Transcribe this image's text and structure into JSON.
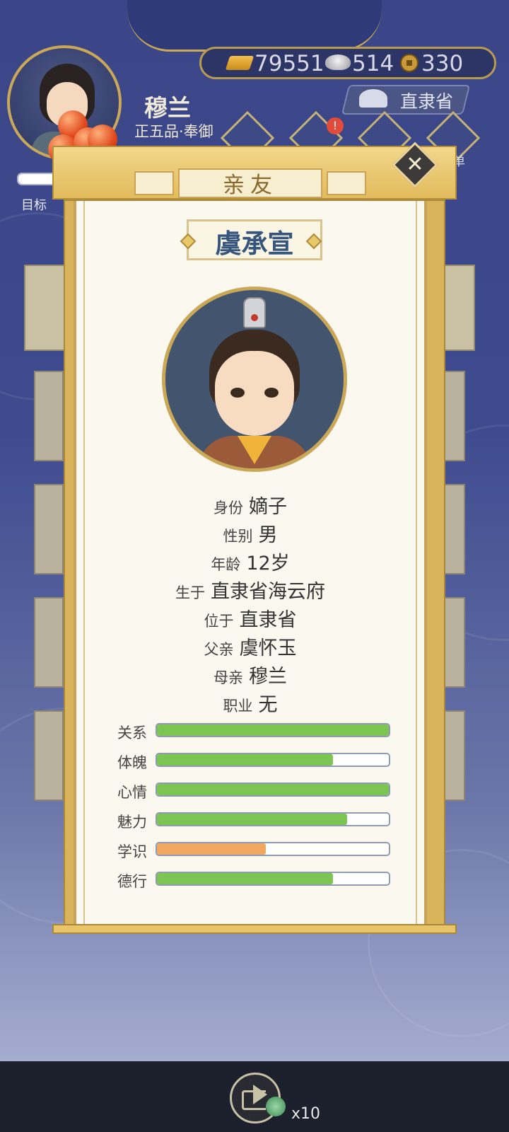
{
  "hud": {
    "gold": "79551",
    "silver": "514",
    "coins": "330",
    "location": "直隶省",
    "player_name": "穆兰",
    "player_rank": "正五品·奉御",
    "goal_label": "目标",
    "goal_progress": 0.9,
    "side_partial_text": "单"
  },
  "panel": {
    "title": "亲友",
    "name": "虞承宣",
    "info": [
      {
        "key": "身份",
        "value": "嫡子"
      },
      {
        "key": "性别",
        "value": "男"
      },
      {
        "key": "年龄",
        "value": "12岁"
      },
      {
        "key": "生于",
        "value": "直隶省海云府"
      },
      {
        "key": "位于",
        "value": "直隶省"
      },
      {
        "key": "父亲",
        "value": "虞怀玉"
      },
      {
        "key": "母亲",
        "value": "穆兰"
      },
      {
        "key": "职业",
        "value": "无"
      }
    ],
    "stats": [
      {
        "label": "关系",
        "value": 1.0,
        "color": "#7cc552"
      },
      {
        "label": "体魄",
        "value": 0.76,
        "color": "#7cc552"
      },
      {
        "label": "心情",
        "value": 1.0,
        "color": "#7cc552"
      },
      {
        "label": "魅力",
        "value": 0.82,
        "color": "#7cc552"
      },
      {
        "label": "学识",
        "value": 0.47,
        "color": "#f1a863"
      },
      {
        "label": "德行",
        "value": 0.76,
        "color": "#7cc552"
      }
    ]
  },
  "share": {
    "count": "x10"
  },
  "icons": [
    "gold-ingot-icon",
    "silver-ingot-icon",
    "copper-coin-icon",
    "brush-icon",
    "close-icon",
    "share-icon",
    "jade-icon",
    "fruit-icon"
  ]
}
